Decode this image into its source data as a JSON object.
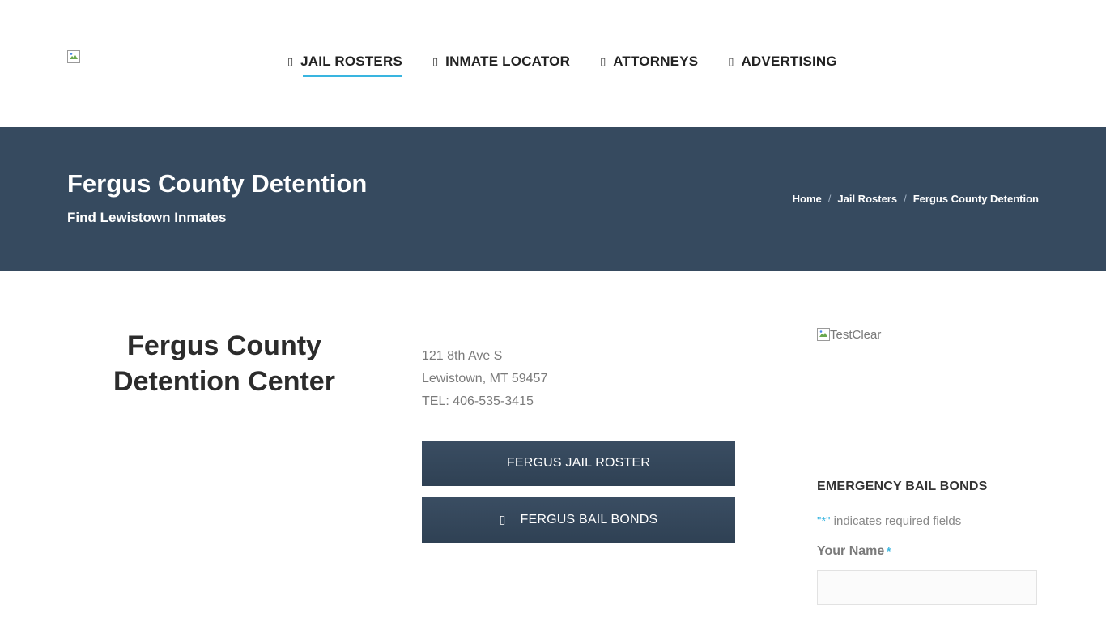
{
  "header": {
    "nav": [
      {
        "glyph": "▯",
        "label": "Jail Rosters",
        "active": true
      },
      {
        "glyph": "▯",
        "label": "Inmate Locator"
      },
      {
        "glyph": "▯",
        "label": "Attorneys"
      },
      {
        "glyph": "▯",
        "label": "Advertising"
      }
    ]
  },
  "banner": {
    "title": "Fergus County Detention",
    "subtitle": "Find Lewistown Inmates",
    "breadcrumb": [
      "Home",
      "Jail Rosters",
      "Fergus County Detention"
    ],
    "separator": "/"
  },
  "main": {
    "facility_name": "Fergus County Detention Center",
    "address_line1": "121 8th Ave S",
    "address_line2": "Lewistown, MT 59457",
    "phone": "TEL: 406-535-3415",
    "roster_button": "FERGUS JAIL ROSTER",
    "bail_button_glyph": "▯",
    "bail_button": "FERGUS BAIL BONDS"
  },
  "sidebar": {
    "ad_alt": "TestClear",
    "widget_title": "EMERGENCY BAIL BONDS",
    "required_quote": "\"*\"",
    "required_note": " indicates required fields",
    "name_label": "Your Name",
    "required_star": "*"
  },
  "colors": {
    "banner_bg": "#364a5f",
    "accent": "#39b5e0",
    "button_bg": "#34475b"
  }
}
